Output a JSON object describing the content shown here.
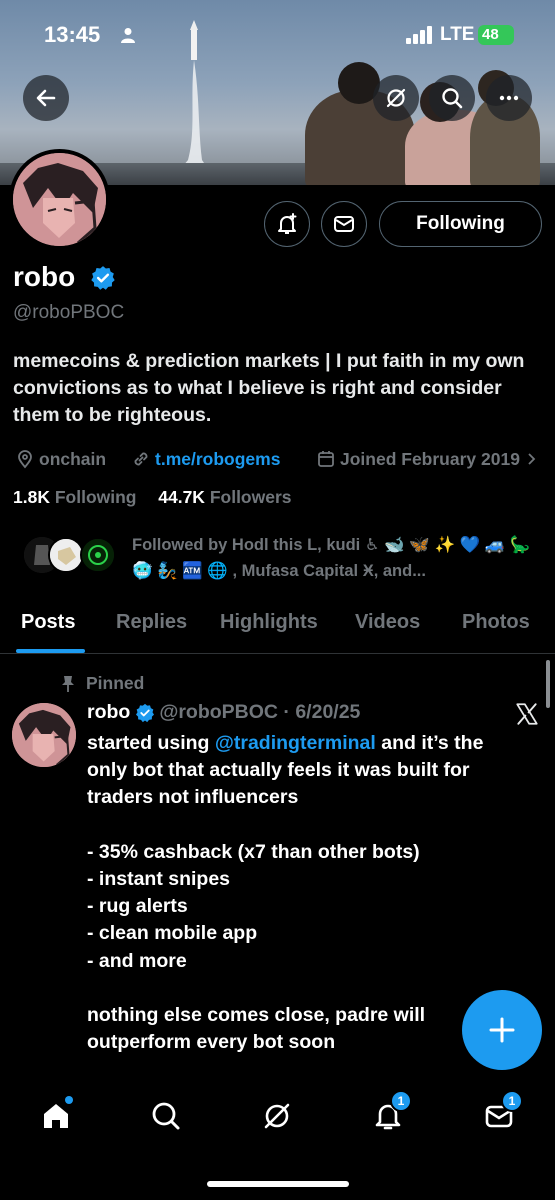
{
  "status_bar": {
    "time": "13:45",
    "carrier": "LTE",
    "battery": "48"
  },
  "profile": {
    "name": "robo",
    "handle": "@roboPBOC",
    "bio": "memecoins & prediction markets | I put faith in my own convictions as to what I believe is right and consider them to be righteous.",
    "location": "onchain",
    "link": "t.me/robogems",
    "joined": "Joined February 2019",
    "following_count": "1.8K",
    "following_label": "Following",
    "followers_count": "44.7K",
    "followers_label": "Followers",
    "followed_by": "Followed by Hodl this L, kudi ♿ 🐋 🦋 ✨ 💙 🚙 🦕 🥶 🧞 🏧 🌐 , Mufasa Capital Ӿ, and...",
    "following_button": "Following"
  },
  "tabs": [
    "Posts",
    "Replies",
    "Highlights",
    "Videos",
    "Photos"
  ],
  "post": {
    "pinned_label": "Pinned",
    "name": "robo",
    "handle_date": "@roboPBOC · 6/20/25",
    "lines": [
      {
        "pre": "started using ",
        "mention": "@tradingterminal",
        "post": " and it’s the"
      },
      {
        "pre": "only bot that actually feels it was built for",
        "mention": "",
        "post": ""
      },
      {
        "pre": "traders not influencers",
        "mention": "",
        "post": ""
      },
      {
        "pre": "",
        "mention": "",
        "post": ""
      },
      {
        "pre": "- 35% cashback (x7 than other bots)",
        "mention": "",
        "post": ""
      },
      {
        "pre": "- instant snipes",
        "mention": "",
        "post": ""
      },
      {
        "pre": "- rug alerts",
        "mention": "",
        "post": ""
      },
      {
        "pre": "- clean mobile app",
        "mention": "",
        "post": ""
      },
      {
        "pre": "- and more",
        "mention": "",
        "post": ""
      },
      {
        "pre": "",
        "mention": "",
        "post": ""
      },
      {
        "pre": "nothing else comes close, padre will",
        "mention": "",
        "post": ""
      },
      {
        "pre": "outperform every bot soon",
        "mention": "",
        "post": ""
      }
    ]
  },
  "nav": {
    "items": [
      "home-icon",
      "search-icon",
      "grok-icon",
      "notifications-icon",
      "messages-icon"
    ],
    "notifications_badge": "1",
    "messages_badge": "1"
  },
  "colors": {
    "accent": "#1d9bf0",
    "text_secondary": "#71767b",
    "battery": "#34c759"
  }
}
